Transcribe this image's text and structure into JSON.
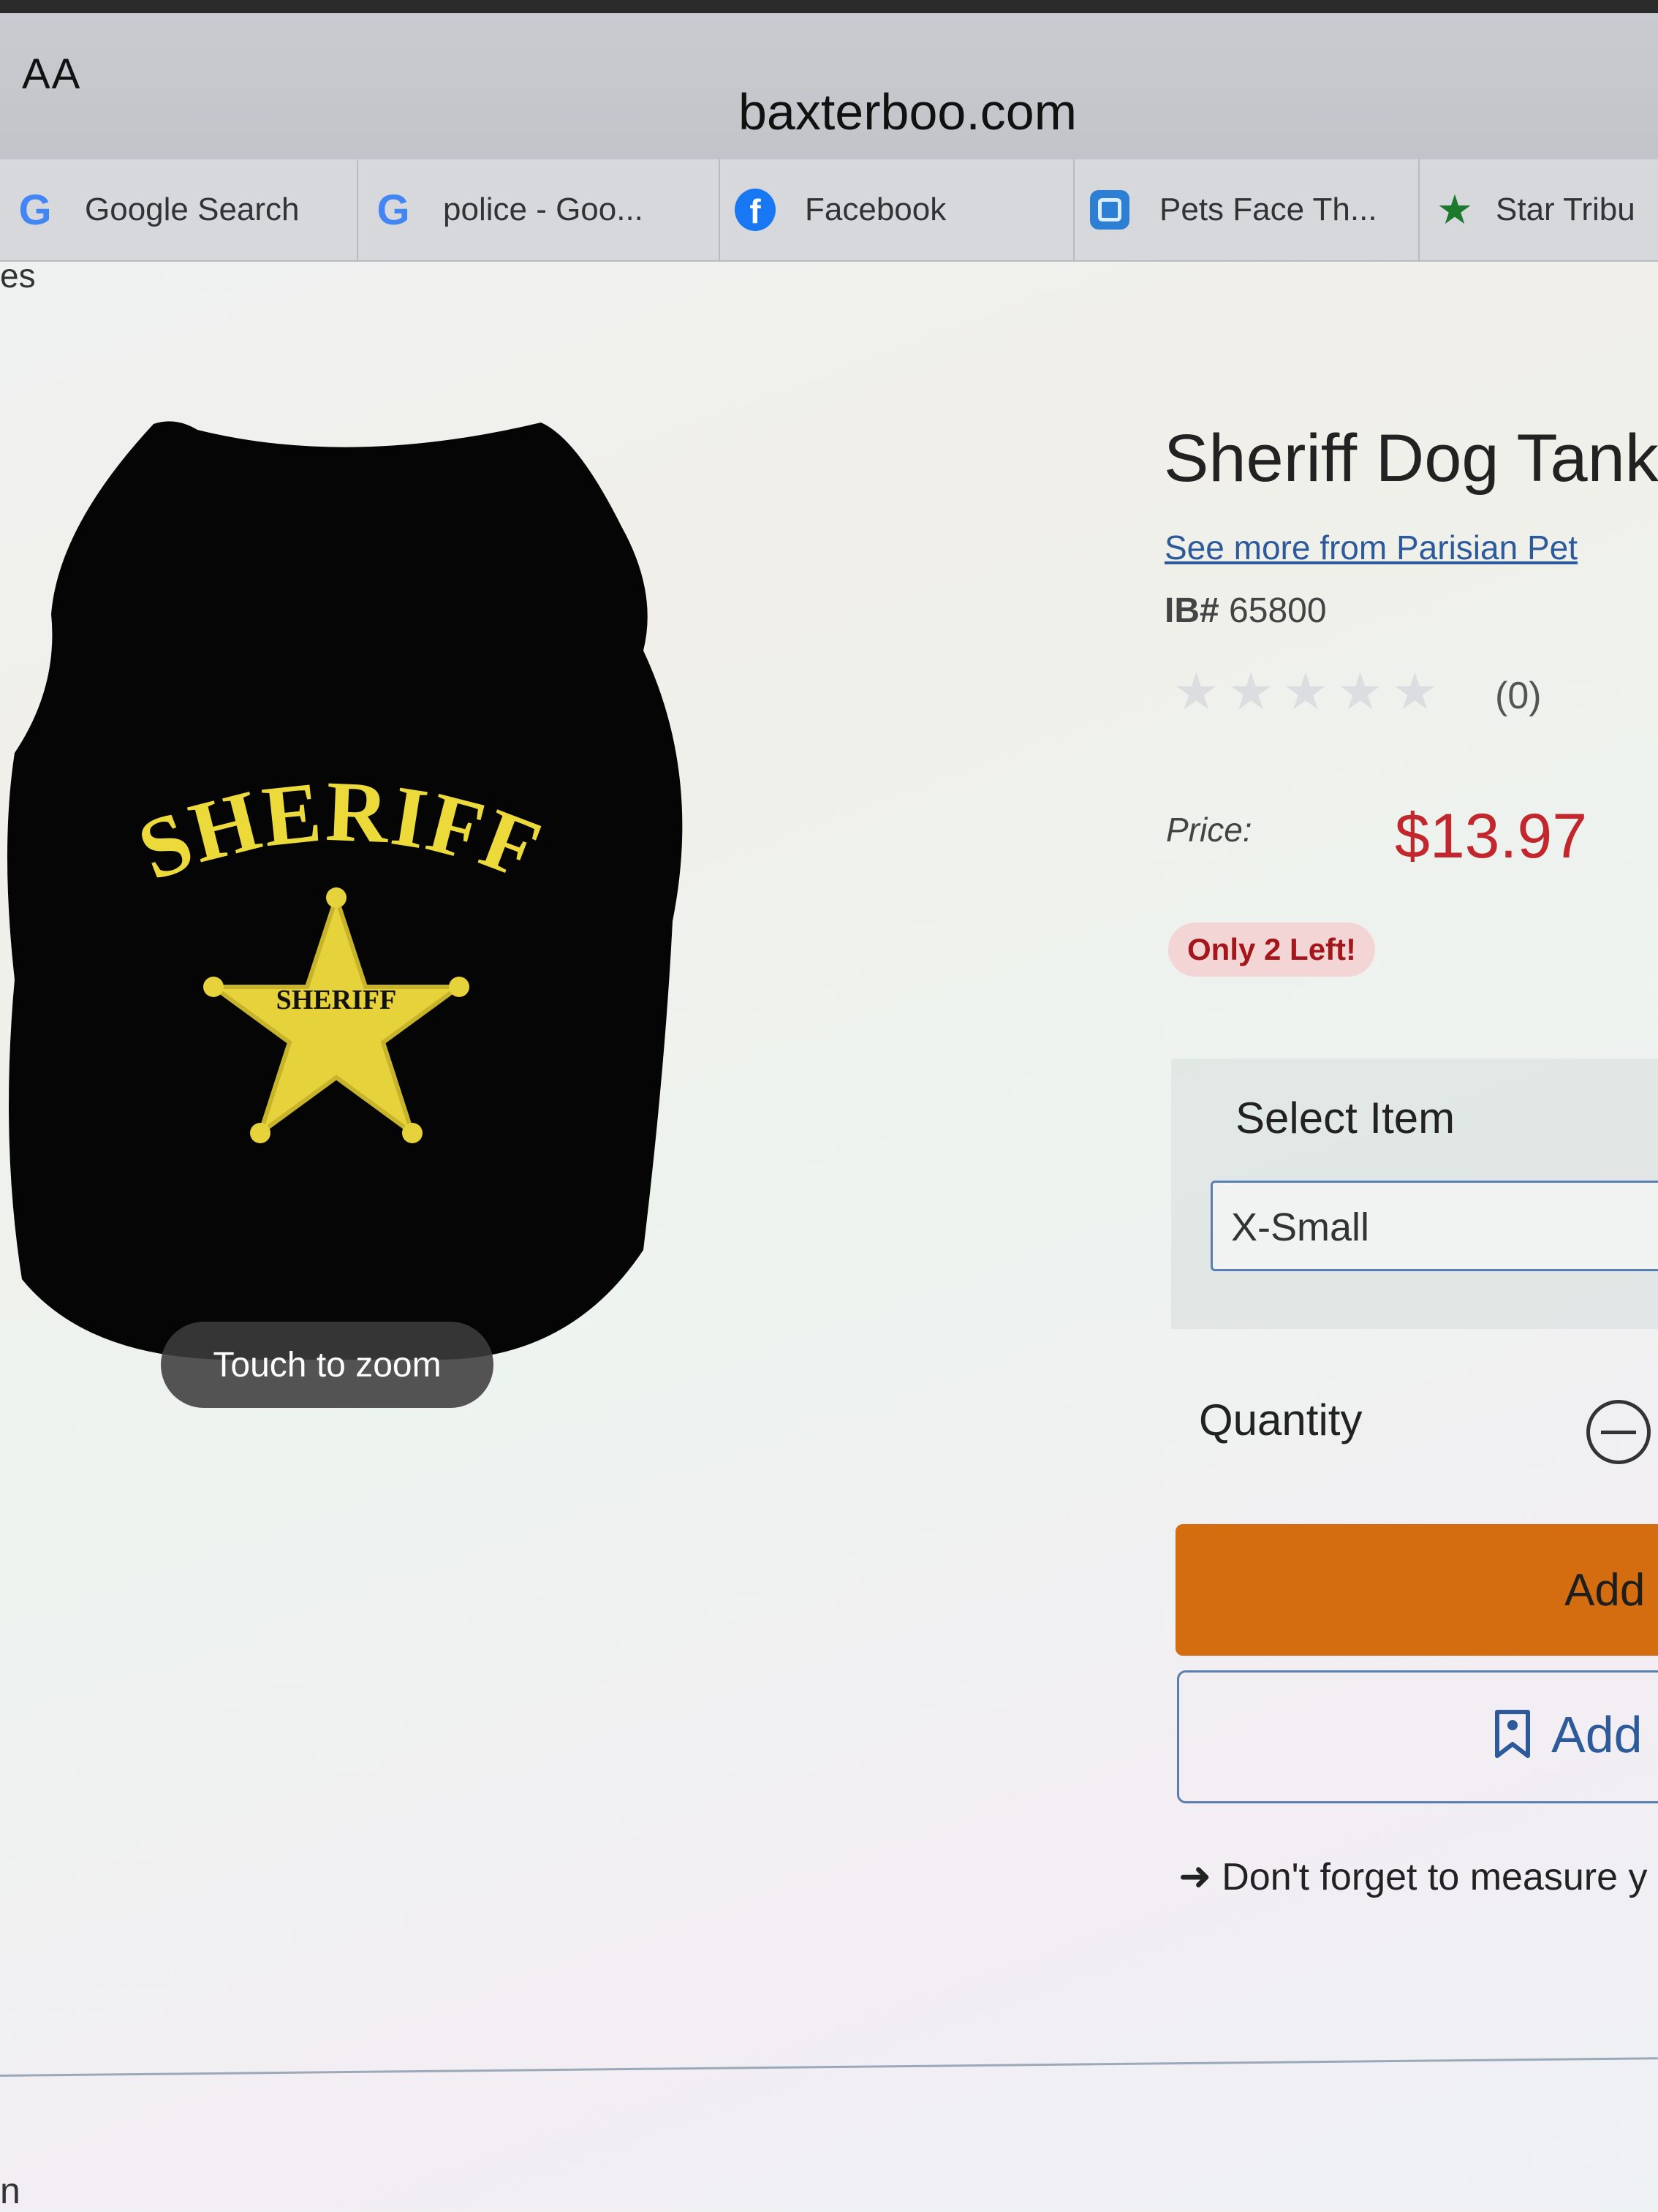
{
  "browser": {
    "text_size_label": "AA",
    "url": "baxterboo.com"
  },
  "tabs": [
    {
      "label": "Google Search",
      "icon": "google-icon"
    },
    {
      "label": "police - Goo...",
      "icon": "google-icon"
    },
    {
      "label": "Facebook",
      "icon": "facebook-icon"
    },
    {
      "label": "Pets Face Th...",
      "icon": "app-icon"
    },
    {
      "label": "Star Tribu",
      "icon": "star-icon"
    }
  ],
  "edge_text_left": "es",
  "product": {
    "image_text": {
      "arc": "SHERIFF",
      "badge": "SHERIFF"
    },
    "zoom_hint": "Touch to zoom",
    "title": "Sheriff Dog Tank b",
    "brand_link": "See more from Parisian Pet",
    "sku_label": "IB#",
    "sku_value": "65800",
    "rating": 0,
    "review_count": "(0)",
    "price_label": "Price:",
    "price": "$13.97",
    "stock_badge": "Only 2 Left!",
    "select_label": "Select Item",
    "select_value": "X-Small",
    "quantity_label": "Quantity",
    "add_to_cart": "Add",
    "add_to_wishlist": "Add",
    "measure_note": "Don't forget to measure y"
  },
  "bottom_edge_text": "n",
  "colors": {
    "price": "#c1272d",
    "add_to_cart": "#d46d0f",
    "link": "#2d5a9a",
    "badge_bg": "#f4d5d6",
    "badge_text": "#a4161a"
  }
}
